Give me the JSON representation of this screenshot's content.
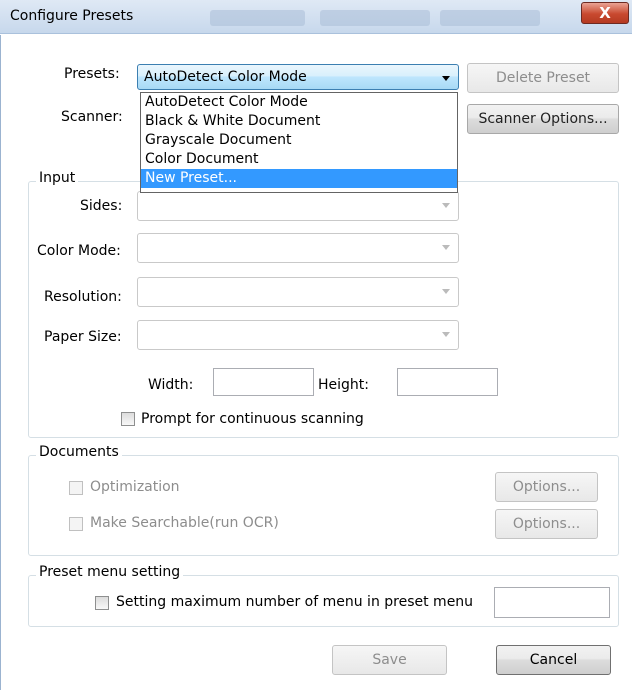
{
  "window": {
    "title": "Configure Presets",
    "close_glyph": "X"
  },
  "presets": {
    "label": "Presets:",
    "selected": "AutoDetect Color Mode",
    "options": [
      "AutoDetect Color Mode",
      "Black & White Document",
      "Grayscale Document",
      "Color Document",
      "New Preset..."
    ],
    "highlighted_index": 4
  },
  "buttons": {
    "delete_preset": "Delete Preset",
    "scanner_options": "Scanner Options...",
    "optimization_options": "Options...",
    "ocr_options": "Options...",
    "save": "Save",
    "cancel": "Cancel"
  },
  "scanner": {
    "label": "Scanner:"
  },
  "input_group": {
    "title": "Input",
    "sides_label": "Sides:",
    "color_mode_label": "Color Mode:",
    "resolution_label": "Resolution:",
    "paper_size_label": "Paper Size:",
    "width_label": "Width:",
    "height_label": "Height:",
    "width_value": "",
    "height_value": "",
    "prompt_continuous": "Prompt for continuous scanning",
    "prompt_checked": false
  },
  "documents_group": {
    "title": "Documents",
    "optimization": "Optimization",
    "make_searchable": "Make Searchable(run OCR)"
  },
  "preset_menu_group": {
    "title": "Preset menu setting",
    "max_setting": "Setting maximum number of menu in preset menu",
    "max_value": ""
  },
  "colors": {
    "highlight": "#3399ff",
    "close_button": "#c8492f",
    "disabled_text": "#8d8d8d"
  }
}
